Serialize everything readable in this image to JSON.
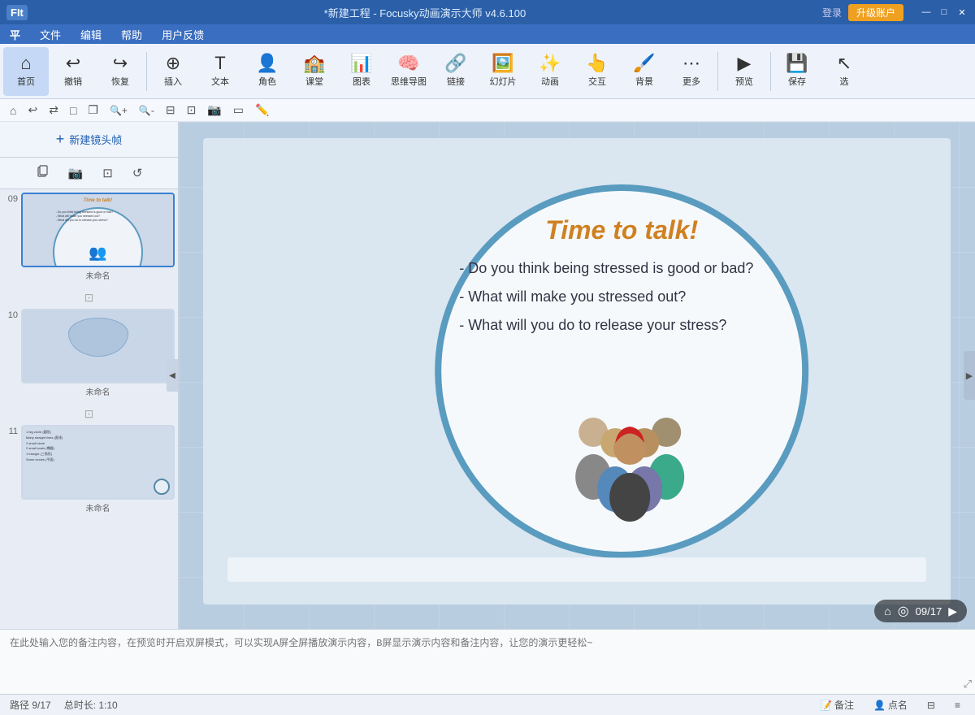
{
  "app": {
    "title": "*新建工程 - Focusky动画演示大师  v4.6.100",
    "login": "登录",
    "upgrade": "升级账户"
  },
  "titlebar": {
    "icon": "FIt",
    "win_min": "—",
    "win_restore": "□",
    "win_close": "✕"
  },
  "menubar": {
    "items": [
      "平",
      "文件",
      "编辑",
      "帮助",
      "用户反馈"
    ]
  },
  "toolbar": {
    "home": "首页",
    "undo": "撤销",
    "redo": "恢复",
    "insert": "插入",
    "text": "文本",
    "role": "角色",
    "classroom": "课堂",
    "chart": "图表",
    "mindmap": "思维导图",
    "link": "链接",
    "slide": "幻灯片",
    "animation": "动画",
    "interact": "交互",
    "background": "背景",
    "more": "更多",
    "preview": "预览",
    "save": "保存",
    "select": "选"
  },
  "subtoolbar": {
    "btns": [
      "⌂",
      "↩",
      "⇄",
      "□",
      "❐",
      "🔍+",
      "🔍-",
      "⊟",
      "⊡",
      "📷",
      "▭",
      "✎"
    ]
  },
  "left_panel": {
    "new_frame": "新建镜头帧",
    "copy_btn": "复制帧",
    "screenshot_btn": "📷",
    "fit_btn": "⊡",
    "reset_btn": "↺"
  },
  "slides": [
    {
      "num": "09",
      "label": "未命名",
      "active": true,
      "title": "Time to talk!",
      "questions": "- Do you think being stressed is good or bad?\n- What will make you stressed out?\n- What will you do to release your stress?"
    },
    {
      "num": "10",
      "label": "未命名",
      "active": false
    },
    {
      "num": "11",
      "label": "未命名",
      "active": false,
      "text_lines": [
        "1 big circle (圆形)",
        "Many straight lines (直线)",
        "2 small circle",
        "2 small ovals (椭圆)",
        "1 triangle (三角形)",
        "Some circles (平面)"
      ]
    }
  ],
  "slide_content": {
    "title": "Time to talk!",
    "q1": "- Do you think being stressed is good or bad?",
    "q2": "- What will make you stressed out?",
    "q3": "- What will you do to release your stress?"
  },
  "page_indicator": {
    "current": "09/17"
  },
  "notes": {
    "placeholder": "在此处输入您的备注内容，在预览时开启双屏模式，可以实现A屏全屏播放演示内容，B屏显示演示内容和备注内容，让您的演示更轻松~"
  },
  "statusbar": {
    "path": "路径 9/17",
    "duration": "总时长: 1:10",
    "notes_btn": "备注",
    "points_btn": "点名"
  }
}
